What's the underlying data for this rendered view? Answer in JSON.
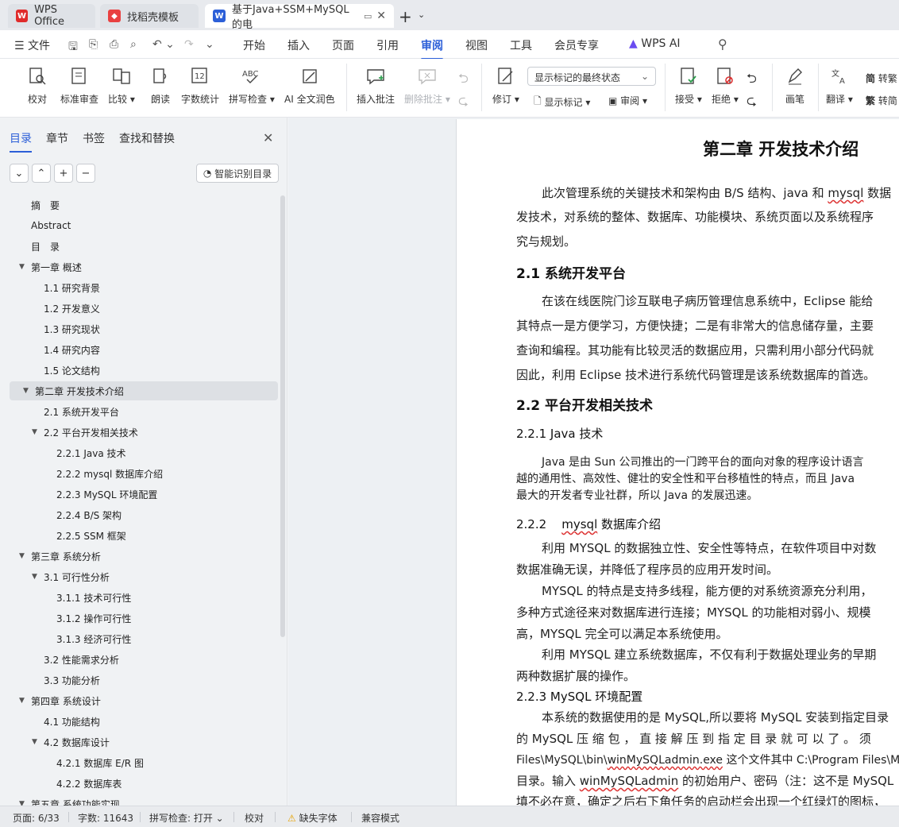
{
  "tabs": [
    {
      "label": "WPS Office",
      "icon": "wps-logo-icon",
      "color": "#e02b2b"
    },
    {
      "label": "找稻壳模板",
      "icon": "docer-icon",
      "color": "#e94040"
    },
    {
      "label": "基于Java+SSM+MySQL的电",
      "icon": "word-doc-icon",
      "color": "#2c5fd8"
    }
  ],
  "menu": {
    "file": "文件",
    "items": [
      "开始",
      "插入",
      "页面",
      "引用",
      "审阅",
      "视图",
      "工具",
      "会员专享"
    ],
    "active": "审阅",
    "wps_ai": "WPS AI"
  },
  "ribbon": {
    "proofread": "校对",
    "standard_review": "标准审查",
    "compare": "比较",
    "read_aloud": "朗读",
    "word_count": "字数统计",
    "spell_check": "拼写检查",
    "ai_polish": "AI 全文润色",
    "insert_comment": "插入批注",
    "delete_comment": "删除批注",
    "revise": "修订",
    "markup_state": "显示标记的最终状态",
    "show_markup": "显示标记",
    "review": "审阅",
    "accept": "接受",
    "reject": "拒绝",
    "pen": "画笔",
    "translate": "翻译",
    "to_trad": "简",
    "to_trad_label": "转繁",
    "to_simp": "繁",
    "to_simp_label": "转简"
  },
  "sidebar": {
    "tabs": [
      "目录",
      "章节",
      "书签",
      "查找和替换"
    ],
    "smart_toc": "智能识别目录",
    "toc": [
      {
        "text": "摘　要",
        "level": 0,
        "toggle": ""
      },
      {
        "text": "Abstract",
        "level": 0,
        "toggle": ""
      },
      {
        "text": "目　录",
        "level": 0,
        "toggle": ""
      },
      {
        "text": "第一章  概述",
        "level": 0,
        "toggle": "▼"
      },
      {
        "text": "1.1 研究背景",
        "level": 1,
        "toggle": ""
      },
      {
        "text": "1.2  开发意义",
        "level": 1,
        "toggle": ""
      },
      {
        "text": "1.3  研究现状",
        "level": 1,
        "toggle": ""
      },
      {
        "text": "1.4  研究内容",
        "level": 1,
        "toggle": ""
      },
      {
        "text": "1.5  论文结构",
        "level": 1,
        "toggle": ""
      },
      {
        "text": "第二章  开发技术介绍",
        "level": 0,
        "toggle": "▼",
        "selected": true
      },
      {
        "text": "2.1  系统开发平台",
        "level": 1,
        "toggle": ""
      },
      {
        "text": "2.2  平台开发相关技术",
        "level": 1,
        "toggle": "▼"
      },
      {
        "text": "2.2.1    Java 技术",
        "level": 2,
        "toggle": ""
      },
      {
        "text": "2.2.2    mysql 数据库介绍",
        "level": 2,
        "toggle": ""
      },
      {
        "text": "2.2.3    MySQL 环境配置",
        "level": 2,
        "toggle": ""
      },
      {
        "text": "2.2.4    B/S 架构",
        "level": 2,
        "toggle": ""
      },
      {
        "text": "2.2.5    SSM 框架",
        "level": 2,
        "toggle": ""
      },
      {
        "text": "第三章  系统分析",
        "level": 0,
        "toggle": "▼"
      },
      {
        "text": "3.1  可行性分析",
        "level": 1,
        "toggle": "▼"
      },
      {
        "text": "3.1.1 技术可行性",
        "level": 2,
        "toggle": ""
      },
      {
        "text": "3.1.2 操作可行性",
        "level": 2,
        "toggle": ""
      },
      {
        "text": "3.1.3  经济可行性",
        "level": 2,
        "toggle": ""
      },
      {
        "text": "3.2 性能需求分析",
        "level": 1,
        "toggle": ""
      },
      {
        "text": "3.3 功能分析",
        "level": 1,
        "toggle": ""
      },
      {
        "text": "第四章  系统设计",
        "level": 0,
        "toggle": "▼"
      },
      {
        "text": "4.1 功能结构",
        "level": 1,
        "toggle": ""
      },
      {
        "text": "4.2  数据库设计",
        "level": 1,
        "toggle": "▼"
      },
      {
        "text": "4.2.1  数据库 E/R 图",
        "level": 2,
        "toggle": ""
      },
      {
        "text": "4.2.2  数据库表",
        "level": 2,
        "toggle": ""
      },
      {
        "text": "第五章  系统功能实现",
        "level": 0,
        "toggle": "▼"
      }
    ]
  },
  "doc": {
    "chapter_title": "第二章  开发技术介绍",
    "intro": [
      "此次管理系统的关键技术和架构由 B/S 结构、java 和 mysql 数据",
      "发技术，对系统的整体、数据库、功能模块、系统页面以及系统程序",
      "究与规划。"
    ],
    "s21_title": "2.1  系统开发平台",
    "s21": [
      "在该在线医院门诊互联电子病历管理信息系统中，Eclipse 能给",
      "其特点一是方便学习，方便快捷；二是有非常大的信息储存量，主要",
      "查询和编程。其功能有比较灵活的数据应用，只需利用小部分代码就",
      "因此，利用 Eclipse 技术进行系统代码管理是该系统数据库的首选。"
    ],
    "s22_title": "2.2  平台开发相关技术",
    "s221_title": "2.2.1    Java 技术",
    "s221": [
      "Java 是由 Sun 公司推出的一门跨平台的面向对象的程序设计语言",
      "越的通用性、高效性、健壮的安全性和平台移植性的特点，而且 Java",
      "最大的开发者专业社群，所以 Java 的发展迅速。"
    ],
    "s222_title": "2.2.2    mysql 数据库介绍",
    "s222": [
      "利用 MYSQL 的数据独立性、安全性等特点，在软件项目中对数",
      "数据准确无误，并降低了程序员的应用开发时间。",
      "MYSQL 的特点是支持多线程，能方便的对系统资源充分利用，",
      "多种方式途径来对数据库进行连接；MYSQL 的功能相对弱小、规模",
      "高，MYSQL 完全可以满足本系统使用。",
      "利用 MYSQL 建立系统数据库，不仅有利于数据处理业务的早期",
      "两种数据扩展的操作。"
    ],
    "s223_title": "2.2.3    MySQL 环境配置",
    "s223": [
      "本系统的数据使用的是 MySQL,所以要将 MySQL 安装到指定目录",
      "的  MySQL  压 缩 包 ， 直 接 解 压 到 指 定 目 录 就 可 以 了 。 须",
      "Files\\MySQL\\bin\\winMySQLadmin.exe 这个文件其中 C:\\Program Files\\M",
      "目录。输入 winMySQLadmin 的初始用户、密码（注：这不是 MySQL",
      "填不必在意，确定之后右下角任务的启动栏会出现一个红绿灯的图标，"
    ]
  },
  "status": {
    "page": "页面: 6/33",
    "words": "字数: 11643",
    "spell": "拼写检查: 打开",
    "proof": "校对",
    "missing_font": "缺失字体",
    "compat": "兼容模式"
  }
}
